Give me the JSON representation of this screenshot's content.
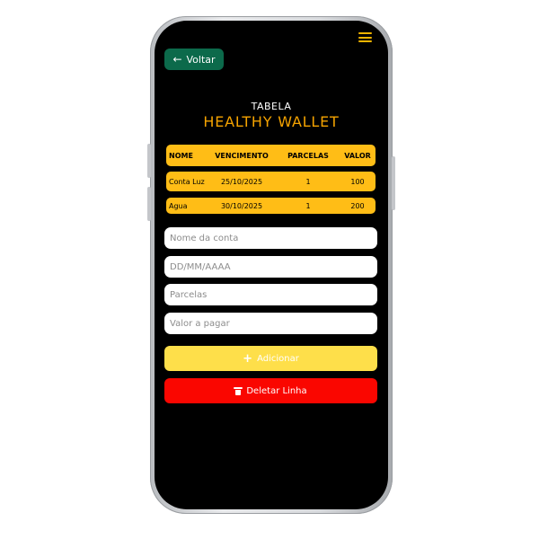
{
  "header": {
    "back_label": "Voltar",
    "subtitle": "TABELA",
    "title": "HEALTHY WALLET"
  },
  "table": {
    "columns": [
      "NOME",
      "VENCIMENTO",
      "PARCELAS",
      "VALOR"
    ],
    "rows": [
      {
        "nome": "Conta Luz",
        "vencimento": "25/10/2025",
        "parcelas": "1",
        "valor": "100"
      },
      {
        "nome": "Agua",
        "vencimento": "30/10/2025",
        "parcelas": "1",
        "valor": "200"
      }
    ]
  },
  "form": {
    "name_placeholder": "Nome da conta",
    "date_placeholder": "DD/MM/AAAA",
    "installments_placeholder": "Parcelas",
    "amount_placeholder": "Valor a pagar",
    "name_value": "",
    "date_value": "",
    "installments_value": "",
    "amount_value": ""
  },
  "actions": {
    "add_label": "Adicionar",
    "delete_label": "Deletar Linha"
  },
  "icons": {
    "back": "arrow-left-icon",
    "menu": "hamburger-menu-icon",
    "add": "plus-icon",
    "delete": "trash-icon"
  },
  "colors": {
    "background": "#000000",
    "back_button": "#0c6a4b",
    "title": "#f5a300",
    "table_row": "#ffbd16",
    "add_button": "#fedf4a",
    "delete_button": "#fa0600"
  }
}
